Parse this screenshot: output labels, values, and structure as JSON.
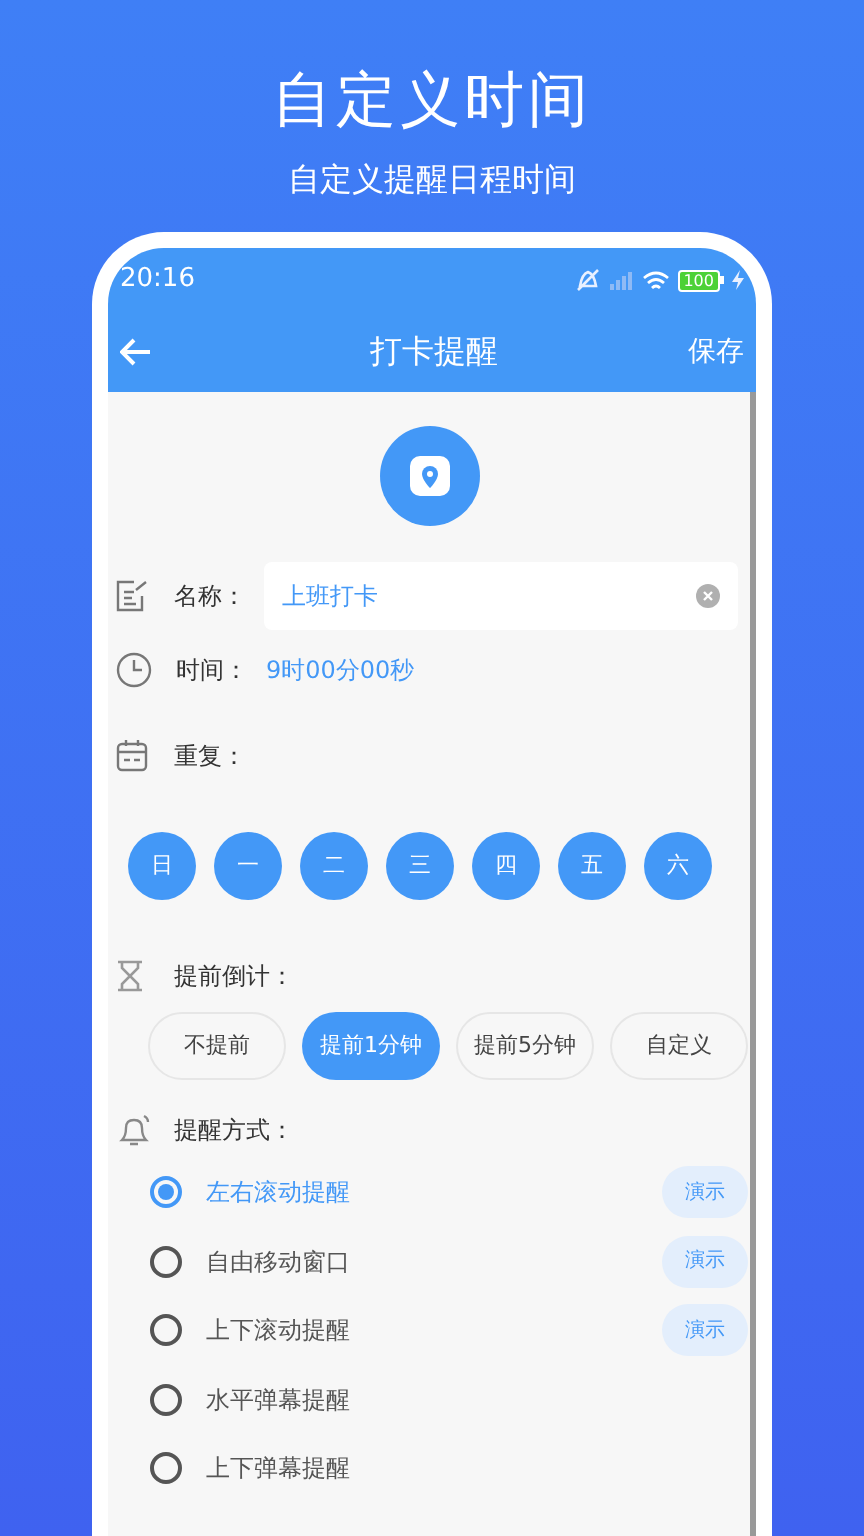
{
  "promo": {
    "title": "自定义时间",
    "subtitle": "自定义提醒日程时间"
  },
  "status_bar": {
    "time": "20:16",
    "battery": "100"
  },
  "header": {
    "title": "打卡提醒",
    "action": "保存"
  },
  "form": {
    "name_label": "名称：",
    "name_value": "上班打卡",
    "time_label": "时间：",
    "time_value": "9时00分00秒",
    "repeat_label": "重复：",
    "days": [
      {
        "label": "日",
        "selected": true
      },
      {
        "label": "一",
        "selected": true
      },
      {
        "label": "二",
        "selected": true
      },
      {
        "label": "三",
        "selected": true
      },
      {
        "label": "四",
        "selected": true
      },
      {
        "label": "五",
        "selected": true
      },
      {
        "label": "六",
        "selected": true
      }
    ],
    "countdown_label": "提前倒计：",
    "countdown_options": [
      {
        "label": "不提前",
        "selected": false
      },
      {
        "label": "提前1分钟",
        "selected": true
      },
      {
        "label": "提前5分钟",
        "selected": false
      },
      {
        "label": "自定义",
        "selected": false
      }
    ],
    "method_label": "提醒方式：",
    "methods": [
      {
        "label": "左右滚动提醒",
        "selected": true,
        "demo": "演示"
      },
      {
        "label": "自由移动窗口",
        "selected": false,
        "demo": "演示"
      },
      {
        "label": "上下滚动提醒",
        "selected": false,
        "demo": "演示"
      },
      {
        "label": "水平弹幕提醒",
        "selected": false
      },
      {
        "label": "上下弹幕提醒",
        "selected": false
      }
    ]
  }
}
